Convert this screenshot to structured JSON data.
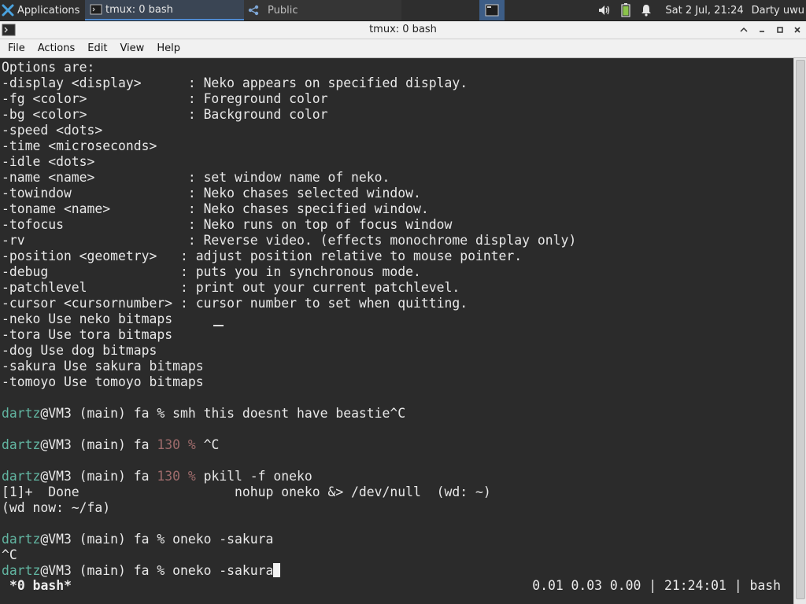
{
  "panel": {
    "applications_label": "Applications",
    "tasks": [
      {
        "label": "tmux: 0 bash"
      },
      {
        "label": "Public"
      }
    ],
    "clock": "Sat  2 Jul, 21:24",
    "user": "Darty uwu"
  },
  "window": {
    "title": "tmux: 0 bash"
  },
  "menu": {
    "file": "File",
    "actions": "Actions",
    "edit": "Edit",
    "view": "View",
    "help": "Help"
  },
  "terminal": {
    "lines": [
      [
        {
          "t": "Options are:"
        }
      ],
      [
        {
          "t": "-display <display>      : Neko appears on specified display."
        }
      ],
      [
        {
          "t": "-fg <color>             : Foreground color"
        }
      ],
      [
        {
          "t": "-bg <color>             : Background color"
        }
      ],
      [
        {
          "t": "-speed <dots>"
        }
      ],
      [
        {
          "t": "-time <microseconds>"
        }
      ],
      [
        {
          "t": "-idle <dots>"
        }
      ],
      [
        {
          "t": "-name <name>            : set window name of neko."
        }
      ],
      [
        {
          "t": "-towindow               : Neko chases selected window."
        }
      ],
      [
        {
          "t": "-toname <name>          : Neko chases specified window."
        }
      ],
      [
        {
          "t": "-tofocus                : Neko runs on top of focus window"
        }
      ],
      [
        {
          "t": "-rv                     : Reverse video. (effects monochrome display only)"
        }
      ],
      [
        {
          "t": "-position <geometry>   : adjust position relative to mouse pointer."
        }
      ],
      [
        {
          "t": "-debug                 : puts you in synchronous mode."
        }
      ],
      [
        {
          "t": "-patchlevel            : print out your current patchlevel."
        }
      ],
      [
        {
          "t": "-cursor <cursornumber> : cursor number to set when quitting."
        }
      ],
      [
        {
          "t": "-neko Use neko bitmaps"
        }
      ],
      [
        {
          "t": "-tora Use tora bitmaps"
        }
      ],
      [
        {
          "t": "-dog Use dog bitmaps"
        }
      ],
      [
        {
          "t": "-sakura Use sakura bitmaps"
        }
      ],
      [
        {
          "t": "-tomoyo Use tomoyo bitmaps"
        }
      ],
      [],
      [
        {
          "t": "dartz",
          "c": "green"
        },
        {
          "t": "@VM3 (main) fa % smh this doesnt have beastie^C"
        }
      ],
      [],
      [
        {
          "t": "dartz",
          "c": "green"
        },
        {
          "t": "@VM3 (main) fa "
        },
        {
          "t": "130 %",
          "c": "red"
        },
        {
          "t": " ^C"
        }
      ],
      [],
      [
        {
          "t": "dartz",
          "c": "green"
        },
        {
          "t": "@VM3 (main) fa "
        },
        {
          "t": "130 %",
          "c": "red"
        },
        {
          "t": " pkill -f oneko"
        }
      ],
      [
        {
          "t": "[1]+  Done                    nohup oneko &> /dev/null  (wd: ~)"
        }
      ],
      [
        {
          "t": "(wd now: ~/fa)"
        }
      ],
      [],
      [
        {
          "t": "dartz",
          "c": "green"
        },
        {
          "t": "@VM3 (main) fa % oneko -sakura"
        }
      ],
      [
        {
          "t": "^C"
        }
      ],
      [
        {
          "t": "dartz",
          "c": "green"
        },
        {
          "t": "@VM3 (main) fa % oneko -sakura"
        }
      ]
    ]
  },
  "tmux_status": {
    "left": "*0 bash*",
    "right": "0.01 0.03 0.00 | 21:24:01 | bash"
  },
  "colors": {
    "prompt_user": "#62b6a2",
    "exit_code": "#9e6b6b",
    "terminal_bg": "#2b2b2b",
    "panel_bg": "#2e2e2e",
    "active_task_accent": "#4f8ad0"
  },
  "icons": [
    "xfce-logo-icon",
    "terminal-icon",
    "share-icon",
    "workspace-icon",
    "volume-icon",
    "battery-icon",
    "notification-bell-icon",
    "chevron-up-icon",
    "minimize-icon",
    "maximize-icon",
    "close-icon"
  ]
}
